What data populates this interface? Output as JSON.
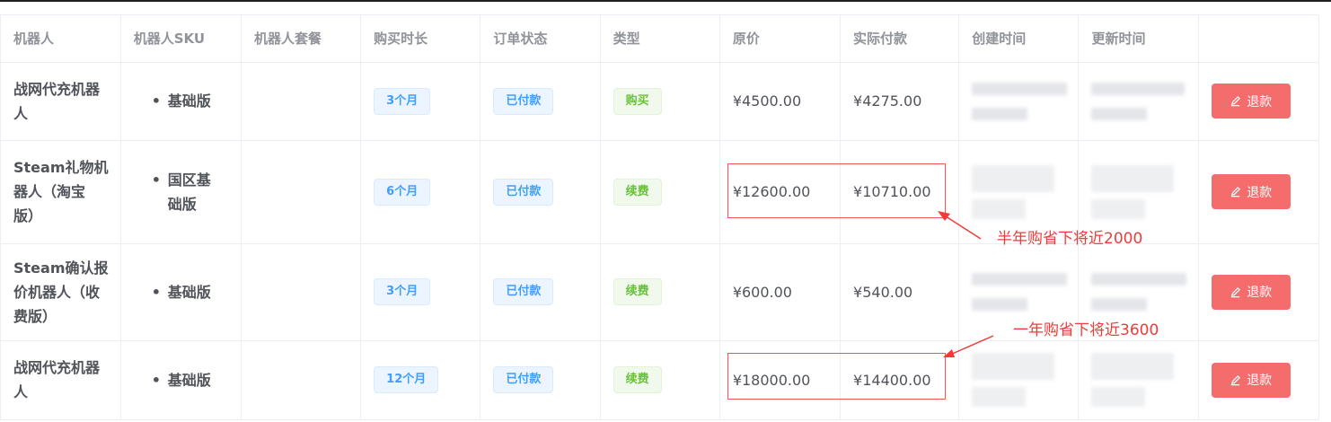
{
  "columns": [
    "机器人",
    "机器人SKU",
    "机器人套餐",
    "购买时长",
    "订单状态",
    "类型",
    "原价",
    "实际付款",
    "创建时间",
    "更新时间",
    ""
  ],
  "rows": [
    {
      "robot_lines": [
        "战网代充机器",
        "人"
      ],
      "sku_lines": [
        "基础版"
      ],
      "package": "",
      "duration": "3个月",
      "status": "已付款",
      "type": "购买",
      "type_color": "green",
      "original_price": "¥4500.00",
      "paid": "¥4275.00",
      "action": "退款"
    },
    {
      "robot_lines": [
        "Steam礼物机",
        "器人（淘宝",
        "版）"
      ],
      "sku_lines": [
        "国区基",
        "础版"
      ],
      "package": "",
      "duration": "6个月",
      "status": "已付款",
      "type": "续费",
      "type_color": "green",
      "original_price": "¥12600.00",
      "paid": "¥10710.00",
      "action": "退款"
    },
    {
      "robot_lines": [
        "Steam确认报",
        "价机器人（收",
        "费版）"
      ],
      "sku_lines": [
        "基础版"
      ],
      "package": "",
      "duration": "3个月",
      "status": "已付款",
      "type": "续费",
      "type_color": "green",
      "original_price": "¥600.00",
      "paid": "¥540.00",
      "action": "退款"
    },
    {
      "robot_lines": [
        "战网代充机器",
        "人"
      ],
      "sku_lines": [
        "基础版"
      ],
      "package": "",
      "duration": "12个月",
      "status": "已付款",
      "type": "续费",
      "type_color": "green",
      "original_price": "¥18000.00",
      "paid": "¥14400.00",
      "action": "退款"
    }
  ],
  "annotations": {
    "half_year": "半年购省下将近2000",
    "one_year": "一年购省下将近3600"
  },
  "colors": {
    "annotation_red": "#f03b3b",
    "refund_button": "#f56c6c",
    "tag_blue": "#409eff",
    "tag_green": "#67c23a"
  },
  "icons": {
    "refund": "edit-pen-icon"
  }
}
